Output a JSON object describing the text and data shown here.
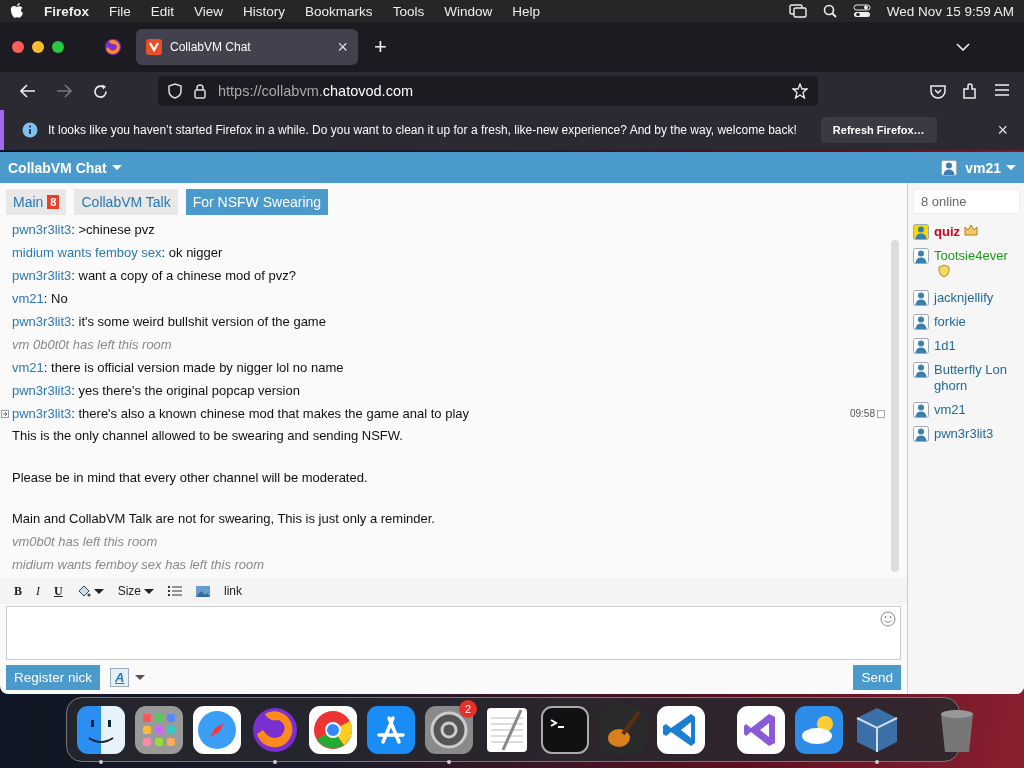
{
  "menu_bar": {
    "app": "Firefox",
    "items": [
      "File",
      "Edit",
      "View",
      "History",
      "Bookmarks",
      "Tools",
      "Window",
      "Help"
    ],
    "clock": "Wed Nov 15  9:59 AM"
  },
  "browser": {
    "tabs": [
      {
        "title": "CollabVM Chat",
        "selected": true
      }
    ],
    "close_symbol": "×",
    "new_tab_symbol": "+",
    "url_host_prefix": "https://collabvm.",
    "url_domain": "chatovod.com",
    "notification": {
      "text": "It looks like you haven’t started Firefox in a while. Do you want to clean it up for a fresh, like-new experience? And by the way, welcome back!",
      "button": "Refresh Firefox…",
      "close_symbol": "×"
    }
  },
  "chat": {
    "title": "CollabVM Chat",
    "user": "vm21",
    "rooms": [
      {
        "label": "Main",
        "badge": "8",
        "selected": false
      },
      {
        "label": "CollabVM Talk",
        "selected": false
      },
      {
        "label": "For NSFW Swearing",
        "selected": true
      }
    ],
    "messages": [
      {
        "kind": "message",
        "user": "pwn3r3lit3",
        "text": ": >chinese pvz"
      },
      {
        "kind": "message",
        "user": "midium wants femboy sex",
        "text": ": ok nigger"
      },
      {
        "kind": "message",
        "user": "pwn3r3lit3",
        "text": ": want a copy of a chinese mod of pvz?"
      },
      {
        "kind": "message",
        "user": "vm21",
        "text": ": No"
      },
      {
        "kind": "message",
        "user": "pwn3r3lit3",
        "text": ": it's some weird bullshit version of the game"
      },
      {
        "kind": "system",
        "text": "vm 0b0t0t has left this room"
      },
      {
        "kind": "message",
        "user": "vm21",
        "text": ": there is official version made by nigger lol no name"
      },
      {
        "kind": "message",
        "user": "pwn3r3lit3",
        "text": ": yes there's the original popcap version"
      },
      {
        "kind": "message",
        "user": "pwn3r3lit3",
        "text": ": there's also a known chinese mod that makes the game anal to play",
        "time": "09:58"
      },
      {
        "kind": "notice",
        "paragraphs": [
          "This is the only channel allowed to be swearing and sending NSFW.",
          "Please be in mind that every other channel will be moderated.",
          "Main and CollabVM Talk are not for swearing, This is just only a reminder."
        ]
      },
      {
        "kind": "system",
        "text": "vm0b0t has left this room"
      },
      {
        "kind": "system",
        "text": "midium wants femboy sex has left this room"
      }
    ],
    "editor_tools": [
      {
        "kind": "bold",
        "label": "B"
      },
      {
        "kind": "italic",
        "label": "I"
      },
      {
        "kind": "underline",
        "label": "U"
      },
      {
        "kind": "color"
      },
      {
        "kind": "size",
        "label": "Size"
      },
      {
        "kind": "list"
      },
      {
        "kind": "image"
      },
      {
        "kind": "link",
        "label": "link"
      }
    ],
    "register_button": "Register nick",
    "font_button": "A",
    "send_button": "Send",
    "online_count": "8 online",
    "users": [
      {
        "name": "quiz",
        "color": "#d0021b",
        "kind": "owner",
        "highlighted": true
      },
      {
        "name": "Tootsie4ever",
        "color": "#1a9a1a",
        "kind": "moderator",
        "highlighted": false
      },
      {
        "name": "jacknjellify",
        "color": "#1f6a96",
        "kind": "user",
        "highlighted": false
      },
      {
        "name": "forkie",
        "color": "#1f6a96",
        "kind": "user",
        "highlighted": false
      },
      {
        "name": "1d1",
        "color": "#1f6a96",
        "kind": "user",
        "highlighted": false
      },
      {
        "name": "Butterfly Longhorn",
        "color": "#1f6a96",
        "kind": "user",
        "highlighted": false
      },
      {
        "name": "vm21",
        "color": "#1f6a96",
        "kind": "user",
        "highlighted": false
      },
      {
        "name": "pwn3r3lit3",
        "color": "#1f6a96",
        "kind": "user",
        "highlighted": false
      }
    ]
  },
  "dock": [
    {
      "kind": "finder",
      "running": true
    },
    {
      "kind": "launchpad",
      "running": false
    },
    {
      "kind": "safari",
      "running": false
    },
    {
      "kind": "firefox",
      "running": true
    },
    {
      "kind": "chrome",
      "running": false
    },
    {
      "kind": "appstore",
      "running": false
    },
    {
      "kind": "settings",
      "running": true,
      "badge": "2"
    },
    {
      "kind": "textedit",
      "running": false
    },
    {
      "kind": "terminal",
      "running": false
    },
    {
      "kind": "garageband",
      "running": false
    },
    {
      "kind": "vscode",
      "running": false
    },
    {
      "kind": "separator"
    },
    {
      "kind": "visualstudio",
      "running": false
    },
    {
      "kind": "weather",
      "running": false
    },
    {
      "kind": "virtualbox",
      "running": true
    },
    {
      "kind": "separator"
    },
    {
      "kind": "trash",
      "running": false
    }
  ]
}
